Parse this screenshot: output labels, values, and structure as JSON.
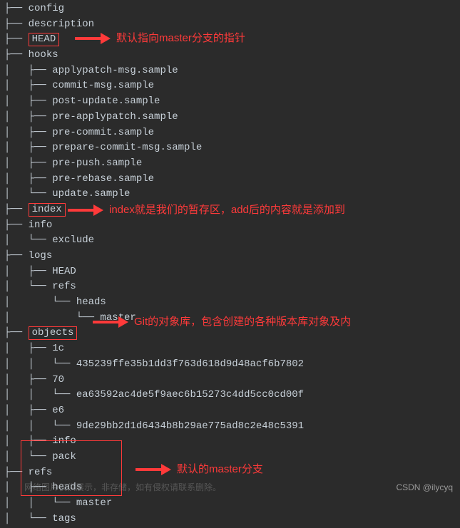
{
  "tree": {
    "config": "config",
    "description": "description",
    "head": "HEAD",
    "hooks": "hooks",
    "hooks_children": [
      "applypatch-msg.sample",
      "commit-msg.sample",
      "post-update.sample",
      "pre-applypatch.sample",
      "pre-commit.sample",
      "prepare-commit-msg.sample",
      "pre-push.sample",
      "pre-rebase.sample",
      "update.sample"
    ],
    "index": "index",
    "info": "info",
    "info_child": "exclude",
    "logs": "logs",
    "logs_head": "HEAD",
    "logs_refs": "refs",
    "logs_heads": "heads",
    "logs_master": "master",
    "objects": "objects",
    "obj_1c": "1c",
    "obj_1c_hash": "435239ffe35b1dd3f763d618d9d48acf6b7802",
    "obj_70": "70",
    "obj_70_hash": "ea63592ac4de5f9aec6b15273c4dd5cc0cd00f",
    "obj_e6": "e6",
    "obj_e6_hash": "9de29bb2d1d6434b8b29ae775ad8c2e48c5391",
    "obj_info": "info",
    "obj_pack": "pack",
    "refs": "refs",
    "refs_heads": "heads",
    "refs_master": "master",
    "refs_tags": "tags"
  },
  "annotations": {
    "head": "默认指向master分支的指针",
    "index": "index就是我们的暂存区，add后的内容就是添加到",
    "objects": "Git的对象库，包含创建的各种版本库对象及内",
    "refs": "默认的master分支"
  },
  "watermark": "CSDN @ilycyq",
  "faint_text": "网络图片仅供展示，非存储，如有侵权请联系删除。"
}
